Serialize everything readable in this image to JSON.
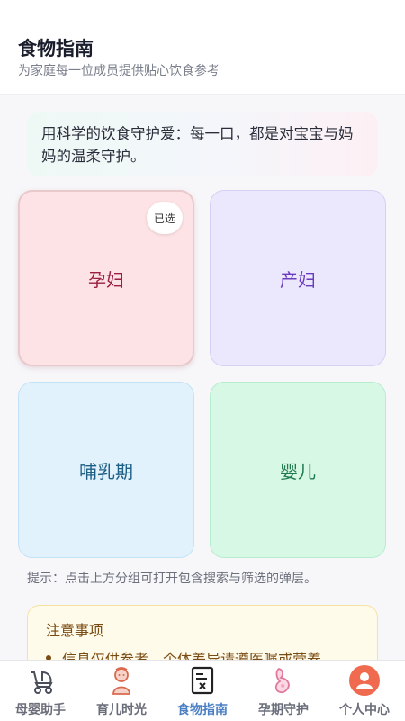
{
  "header": {
    "title": "食物指南",
    "subtitle": "为家庭每一位成员提供贴心饮食参考"
  },
  "banner": {
    "text": "用科学的饮食守护爱：每一口，都是对宝宝与妈妈的温柔守护。"
  },
  "groups": [
    {
      "label": "孕妇",
      "selected": true,
      "badge": "已选"
    },
    {
      "label": "产妇",
      "selected": false
    },
    {
      "label": "哺乳期",
      "selected": false
    },
    {
      "label": "婴儿",
      "selected": false
    }
  ],
  "hint": "提示：点击上方分组可打开包含搜索与筛选的弹层。",
  "notice": {
    "title": "注意事项",
    "items": [
      "信息仅供参考，个体差异请遵医嘱或营养"
    ]
  },
  "tabbar": {
    "active": "食物指南",
    "tabs": [
      {
        "label": "母婴助手",
        "icon": "stroller-icon"
      },
      {
        "label": "育儿时光",
        "icon": "baby-icon"
      },
      {
        "label": "食物指南",
        "icon": "food-guide-icon"
      },
      {
        "label": "孕期守护",
        "icon": "pregnancy-icon"
      },
      {
        "label": "个人中心",
        "icon": "user-icon"
      }
    ]
  },
  "colors": {
    "accent": "#4a7fc4",
    "pregnant": "#fde3e5",
    "postpartum": "#ebe8fd",
    "lactation": "#e2f2fd",
    "infant": "#d8f8e6"
  }
}
